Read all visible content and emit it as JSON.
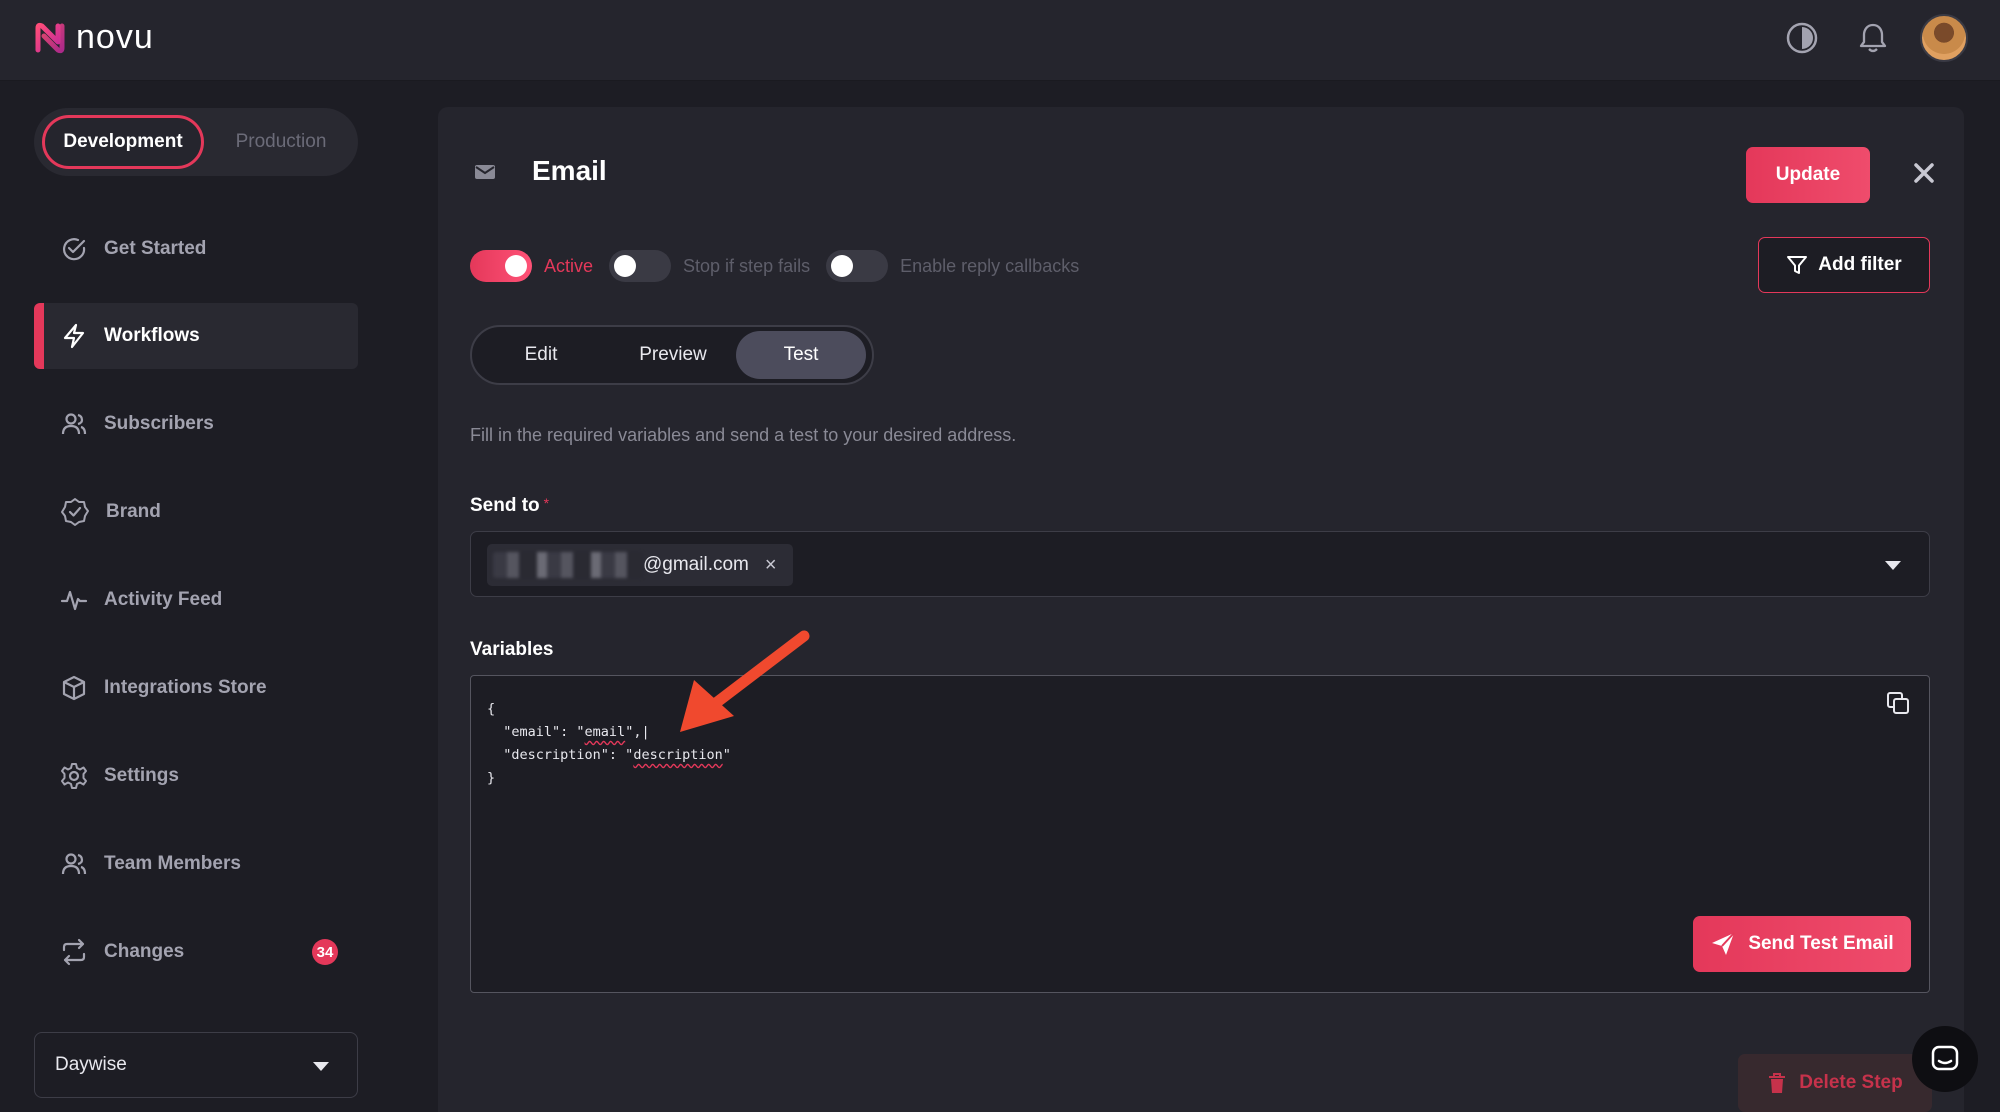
{
  "app": {
    "logo_text": "novu"
  },
  "topbar": {
    "icons": [
      "theme-toggle-icon",
      "bell-icon"
    ],
    "avatar": "user-avatar"
  },
  "sidebar": {
    "environment": {
      "development": "Development",
      "production": "Production",
      "selected": "Development"
    },
    "items": [
      {
        "label": "Get Started",
        "icon": "check-circle-icon"
      },
      {
        "label": "Workflows",
        "icon": "bolt-icon",
        "active": true
      },
      {
        "label": "Subscribers",
        "icon": "users-icon"
      },
      {
        "label": "Brand",
        "icon": "badge-check-icon"
      },
      {
        "label": "Activity Feed",
        "icon": "activity-icon"
      },
      {
        "label": "Integrations Store",
        "icon": "box-icon"
      },
      {
        "label": "Settings",
        "icon": "gear-icon"
      },
      {
        "label": "Team Members",
        "icon": "team-icon"
      },
      {
        "label": "Changes",
        "icon": "repeat-icon",
        "badge": "34"
      }
    ],
    "organization": "Daywise"
  },
  "panel": {
    "title": "Email",
    "update_label": "Update",
    "add_filter_label": "Add filter",
    "toggles": [
      {
        "label": "Active",
        "on": true
      },
      {
        "label": "Stop if step fails",
        "on": false
      },
      {
        "label": "Enable reply callbacks",
        "on": false
      }
    ],
    "tabs": [
      {
        "label": "Edit",
        "active": false
      },
      {
        "label": "Preview",
        "active": false
      },
      {
        "label": "Test",
        "active": true
      }
    ],
    "description": "Fill in the required variables and send a test to your desired address.",
    "send_to": {
      "label": "Send to",
      "required_mark": "*",
      "chip_value": "@gmail.com",
      "chip_remove": "×"
    },
    "variables": {
      "label": "Variables",
      "code": {
        "open": "{",
        "line1_key": "\"email\": \"",
        "line1_val": "email",
        "line1_end": "\",",
        "line2_key": "\"description\": \"",
        "line2_val": "description",
        "line2_end": "\"",
        "close": "}"
      }
    },
    "send_test_label": "Send Test Email",
    "delete_step_label": "Delete Step"
  },
  "colors": {
    "accent": "#e4385a",
    "background": "#1d1d24",
    "panel": "#25252d"
  }
}
